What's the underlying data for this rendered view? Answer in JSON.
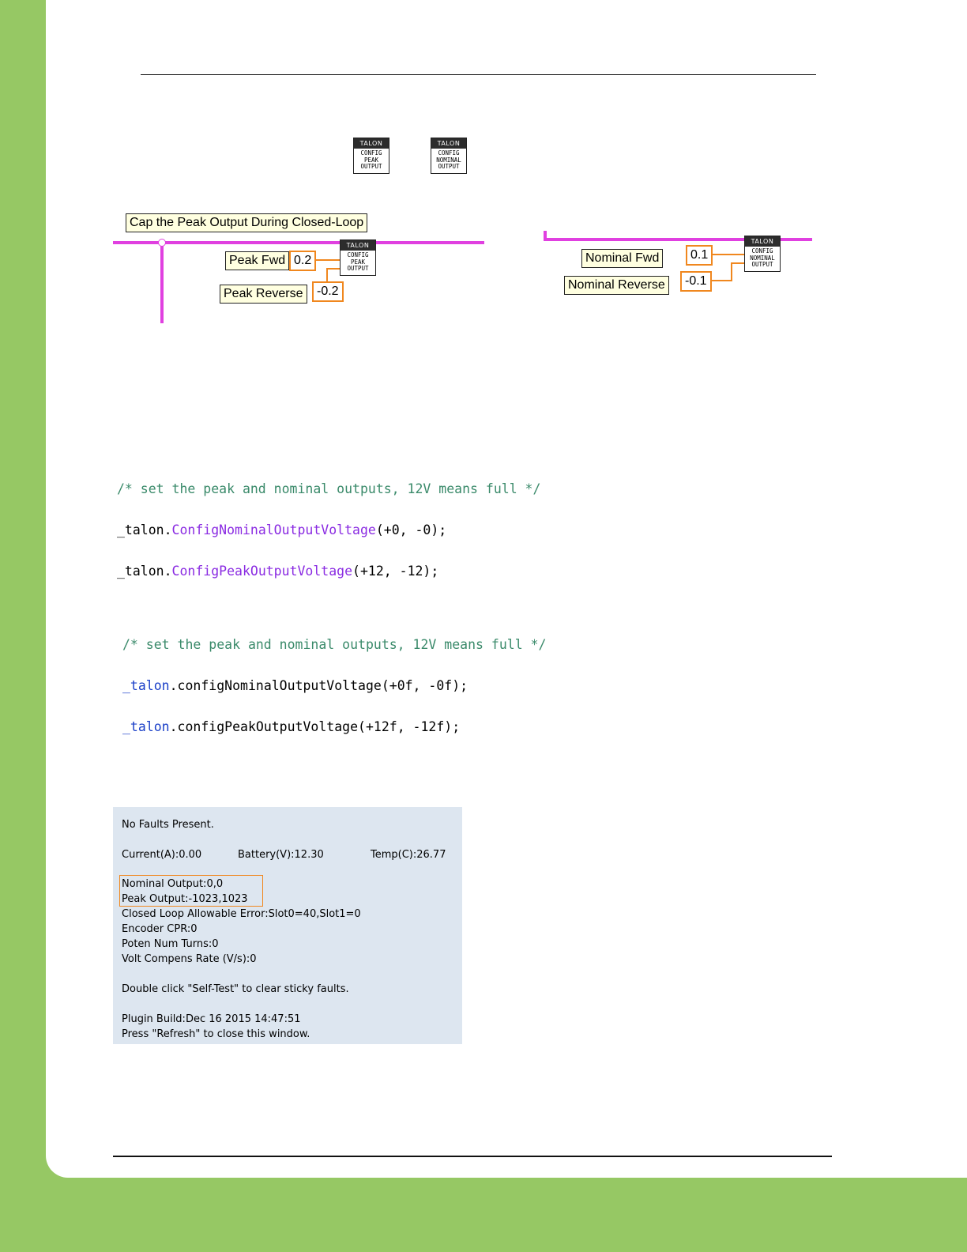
{
  "labview": {
    "icon_peak": {
      "hdr": "TALON",
      "body": "CONFIG\nPEAK\nOUTPUT"
    },
    "icon_nominal": {
      "hdr": "TALON",
      "body": "CONFIG\nNOMINAL\nOUTPUT"
    },
    "left": {
      "title": "Cap the Peak Output During Closed-Loop",
      "peak_fwd_label": "Peak Fwd",
      "peak_fwd_value": "0.2",
      "peak_rev_label": "Peak Reverse",
      "peak_rev_value": "-0.2"
    },
    "right": {
      "nominal_fwd_label": "Nominal Fwd",
      "nominal_fwd_value": "0.1",
      "nominal_rev_label": "Nominal Reverse",
      "nominal_rev_value": "-0.1"
    }
  },
  "cpp_code": {
    "comment": "/* set the peak and nominal outputs, 12V means full */",
    "line1_obj": "_talon.",
    "line1_fn": "ConfigNominalOutputVoltage",
    "line1_args": "(+0, -0);",
    "line2_obj": "_talon.",
    "line2_fn": "ConfigPeakOutputVoltage",
    "line2_args": "(+12, -12);"
  },
  "java_code": {
    "comment": "/* set the peak and nominal outputs, 12V means full */",
    "line1_obj": "_talon",
    "line1_rest": ".configNominalOutputVoltage(+0f, -0f);",
    "line2_obj": "_talon",
    "line2_rest": ".configPeakOutputVoltage(+12f, -12f);"
  },
  "status_panel": {
    "faults": "No Faults Present.",
    "current": "Current(A):0.00",
    "battery": "Battery(V):12.30",
    "temp": "Temp(C):26.77",
    "nominal_output": "Nominal Output:0,0",
    "peak_output": "Peak Output:-1023,1023",
    "closed_loop_error": "Closed Loop Allowable Error:Slot0=40,Slot1=0",
    "encoder_cpr": "Encoder CPR:0",
    "poten_turns": "Poten Num Turns:0",
    "volt_compens": "Volt Compens Rate (V/s):0",
    "double_click": "Double click \"Self-Test\" to clear sticky faults.",
    "plugin_build": "Plugin Build:Dec 16 2015 14:47:51",
    "press_refresh": "Press \"Refresh\" to close this window."
  }
}
